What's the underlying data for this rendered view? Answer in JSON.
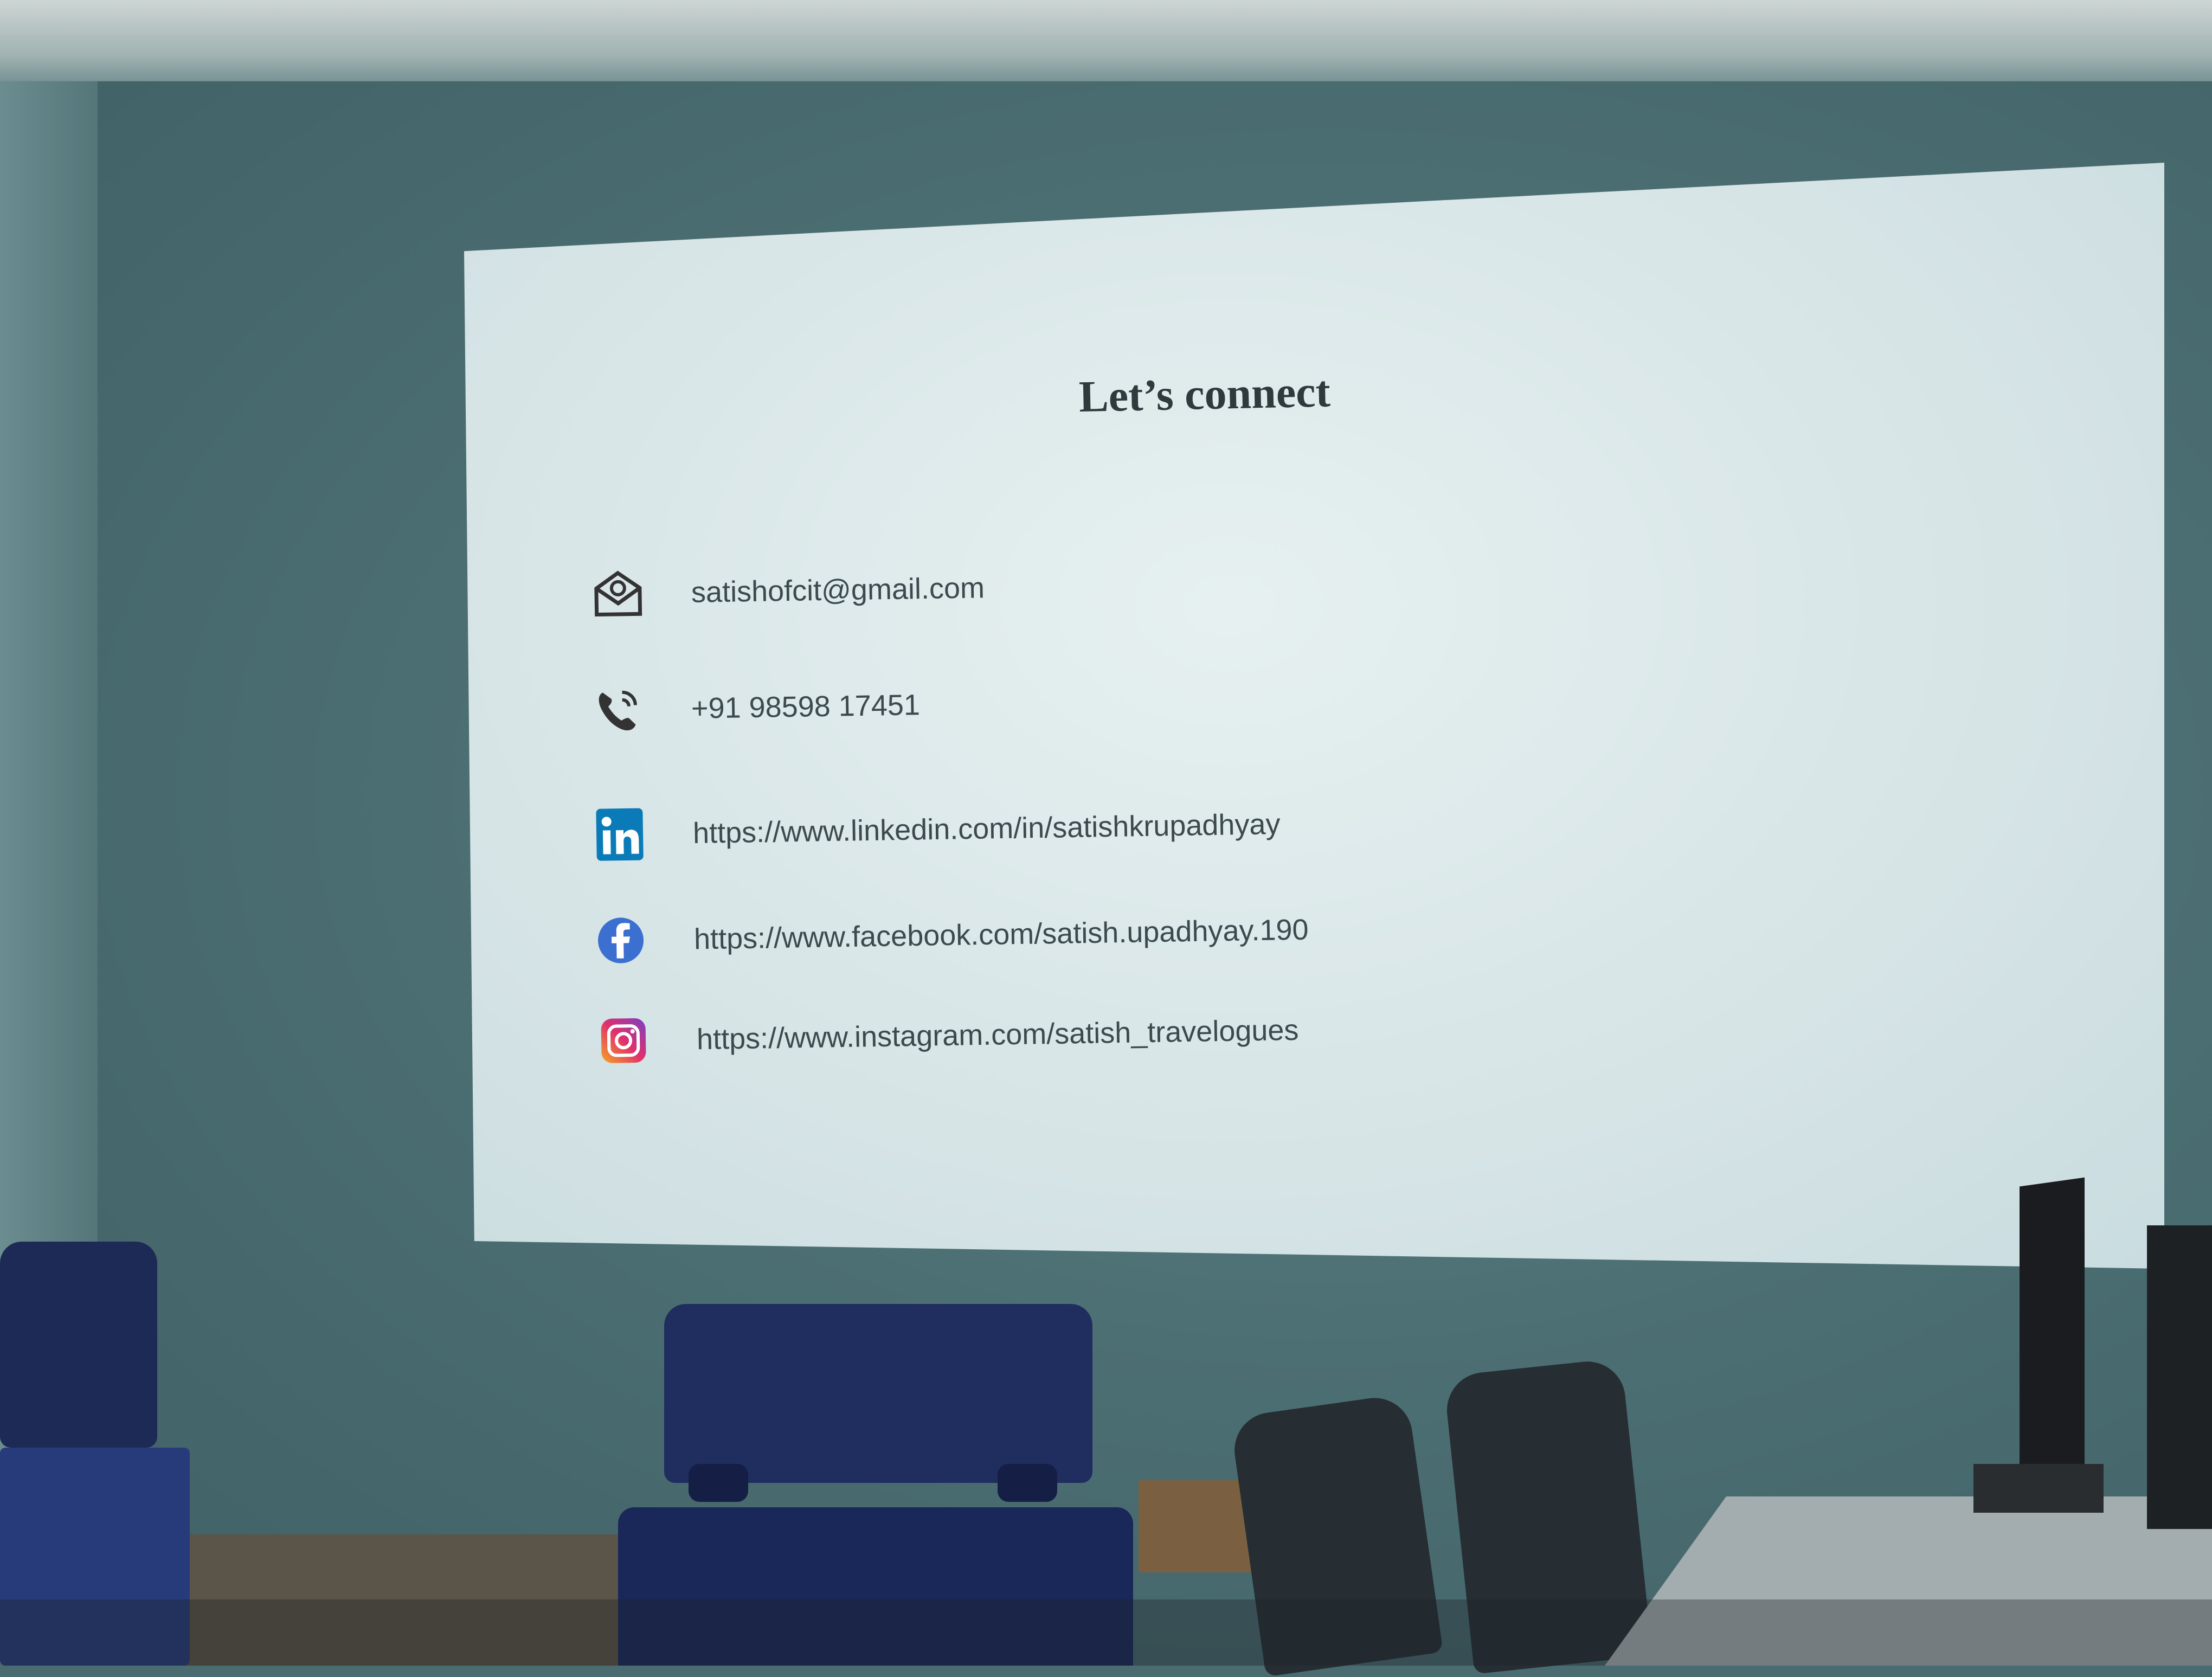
{
  "slide": {
    "title": "Let’s connect",
    "contacts": [
      {
        "icon": "email-icon",
        "text": "satishofcit@gmail.com"
      },
      {
        "icon": "phone-icon",
        "text": "+91 98598 17451"
      },
      {
        "icon": "linkedin-icon",
        "text": "https://www.linkedin.com/in/satishkrupadhyay"
      },
      {
        "icon": "facebook-icon",
        "text": "https://www.facebook.com/satish.upadhyay.190"
      },
      {
        "icon": "instagram-icon",
        "text": "https://www.instagram.com/satish_travelogues"
      }
    ]
  },
  "colors": {
    "wall": "#4c6f73",
    "screen": "#d6e4e6",
    "text": "#3c4a4f",
    "linkedin": "#0a7bb8",
    "facebook": "#3b6fd0",
    "chair_blue": "#1f2d5f"
  }
}
